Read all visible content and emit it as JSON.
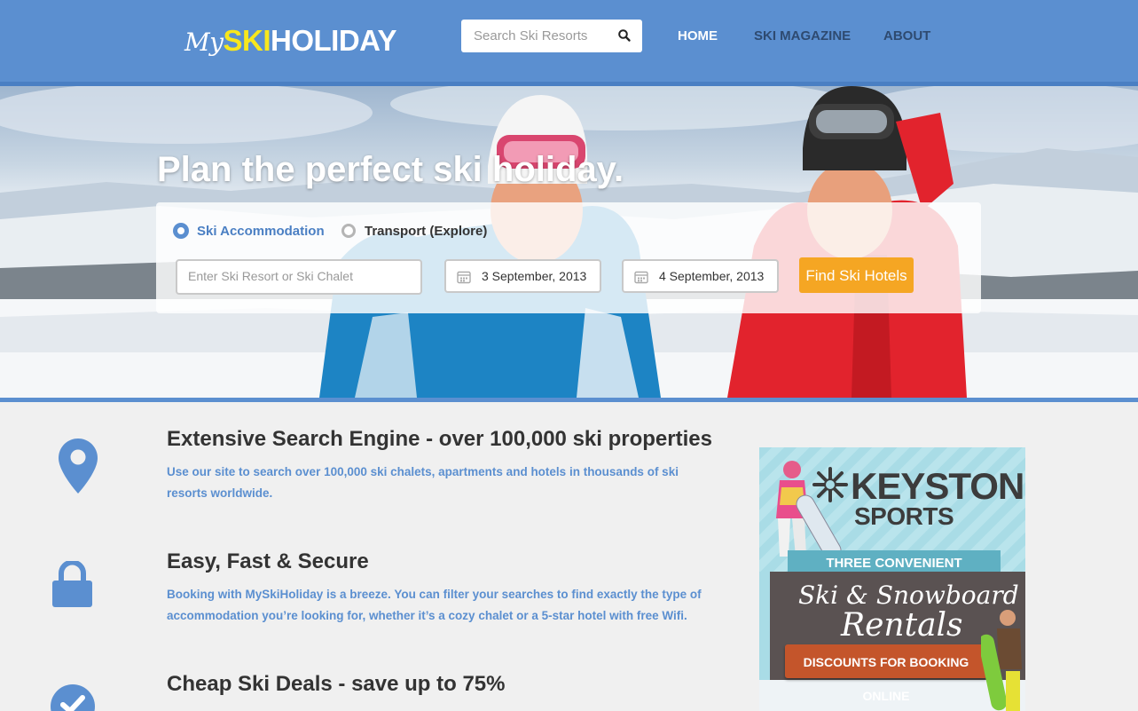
{
  "header": {
    "logo": {
      "part1": "My",
      "part2": "SKI",
      "part3": "HOLIDAY"
    },
    "search": {
      "placeholder": "Search Ski Resorts",
      "icon": "search-icon"
    },
    "nav": [
      {
        "label": "HOME",
        "active": true
      },
      {
        "label": "SKI MAGAZINE",
        "active": false
      },
      {
        "label": "ABOUT",
        "active": false
      }
    ]
  },
  "hero": {
    "title": "Plan the perfect ski holiday.",
    "options": [
      {
        "label": "Ski Accommodation",
        "selected": true
      },
      {
        "label": "Transport (Explore)",
        "selected": false
      }
    ],
    "resort_placeholder": "Enter Ski Resort or Ski Chalet",
    "checkin": "3 September, 2013",
    "checkout": "4 September, 2013",
    "button": "Find Ski Hotels"
  },
  "features": [
    {
      "icon": "map-pin-icon",
      "title": "Extensive Search Engine - over 100,000 ski properties",
      "description": "Use our site to search over 100,000 ski chalets, apartments and hotels in thousands of ski resorts worldwide."
    },
    {
      "icon": "lock-icon",
      "title": "Easy, Fast & Secure",
      "description": "Booking with MySkiHoliday is a breeze. You can filter your searches to find exactly the type of accommodation you’re looking for, whether it’s a cozy chalet or a 5-star hotel with free Wifi."
    },
    {
      "icon": "check-icon",
      "title": "Cheap Ski Deals - save up to 75%",
      "description": ""
    }
  ],
  "ad": {
    "brand_line1": "KEYSTONE",
    "brand_line2": "SPORTS",
    "locations": "THREE CONVENIENT LOCATIONS",
    "rentals_line1": "Ski & Snowboard",
    "rentals_line2": "Rentals",
    "cta": "DISCOUNTS FOR BOOKING ONLINE"
  },
  "colors": {
    "header": "#5b8fd0",
    "accent_yellow": "#f8e71c",
    "button_orange": "#f5a623",
    "feature_text": "#5b8fd0"
  }
}
